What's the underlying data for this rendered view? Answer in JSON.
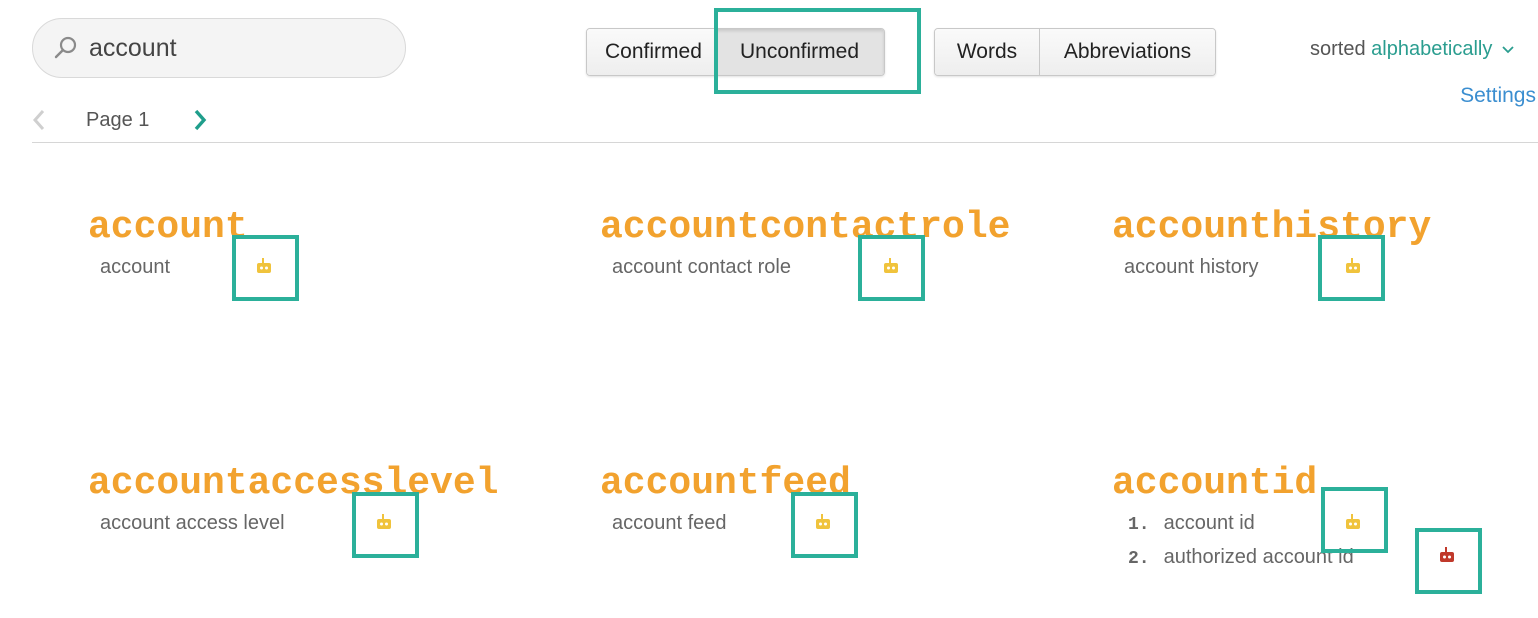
{
  "search": {
    "value": "account",
    "icon": "search-icon"
  },
  "status_toggle": {
    "confirmed": "Confirmed",
    "unconfirmed": "Unconfirmed",
    "selected": "Unconfirmed"
  },
  "type_toggle": {
    "words": "Words",
    "abbreviations": "Abbreviations"
  },
  "sort": {
    "prefix": "sorted",
    "mode": "alphabetically"
  },
  "settings_label": "Settings",
  "pager": {
    "label": "Page 1"
  },
  "colors": {
    "term": "#f2a22e",
    "robot_yellow": "#f0c33c",
    "robot_red": "#c0392b",
    "highlight": "#2bb09a",
    "link": "#2a9d8f",
    "settings": "#3b8ed0"
  },
  "entries": [
    {
      "term": "account",
      "expansions": [
        "account"
      ],
      "robot": "robot-icon"
    },
    {
      "term": "accountcontactrole",
      "expansions": [
        "account contact role"
      ],
      "robot": "robot-icon"
    },
    {
      "term": "accounthistory",
      "expansions": [
        "account history"
      ],
      "robot": "robot-icon"
    },
    {
      "term": "accountaccesslevel",
      "expansions": [
        "account access level"
      ],
      "robot": "robot-icon"
    },
    {
      "term": "accountfeed",
      "expansions": [
        "account feed"
      ],
      "robot": "robot-icon"
    },
    {
      "term": "accountid",
      "expansions": [
        "account id",
        "authorized account id"
      ],
      "numbers": [
        "1.",
        "2."
      ],
      "robot": "robot-icon"
    }
  ]
}
